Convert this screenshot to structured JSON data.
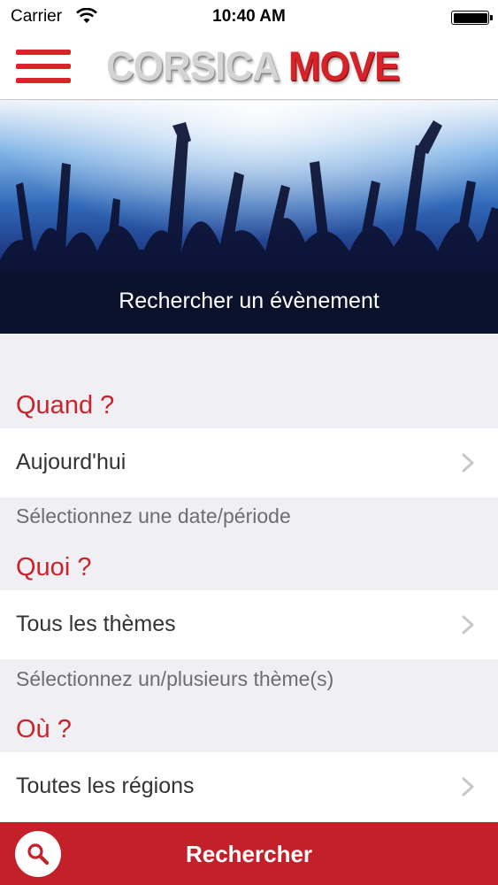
{
  "status_bar": {
    "carrier": "Carrier",
    "time": "10:40 AM",
    "wifi_icon": "wifi-icon",
    "battery_icon": "battery-icon"
  },
  "nav": {
    "menu_icon": "hamburger-menu-icon",
    "logo_part1": "CORSICA",
    "logo_part2": "MOVE"
  },
  "banner": {
    "image": "concert-crowd-image",
    "title": "Rechercher un évènement"
  },
  "sections": {
    "when": {
      "header": "Quand ?",
      "value": "Aujourd'hui",
      "hint": "Sélectionnez une date/période"
    },
    "what": {
      "header": "Quoi ?",
      "value": "Tous les thèmes",
      "hint": "Sélectionnez un/plusieurs thème(s)"
    },
    "where": {
      "header": "Où ?",
      "value": "Toutes les régions"
    }
  },
  "footer": {
    "search_icon": "search-icon",
    "search_label": "Rechercher"
  },
  "colors": {
    "accent": "#c9232b",
    "button_bg": "#c3202a",
    "background": "#efeff4",
    "row_bg": "#ffffff",
    "hint_text": "#6d6d72"
  }
}
